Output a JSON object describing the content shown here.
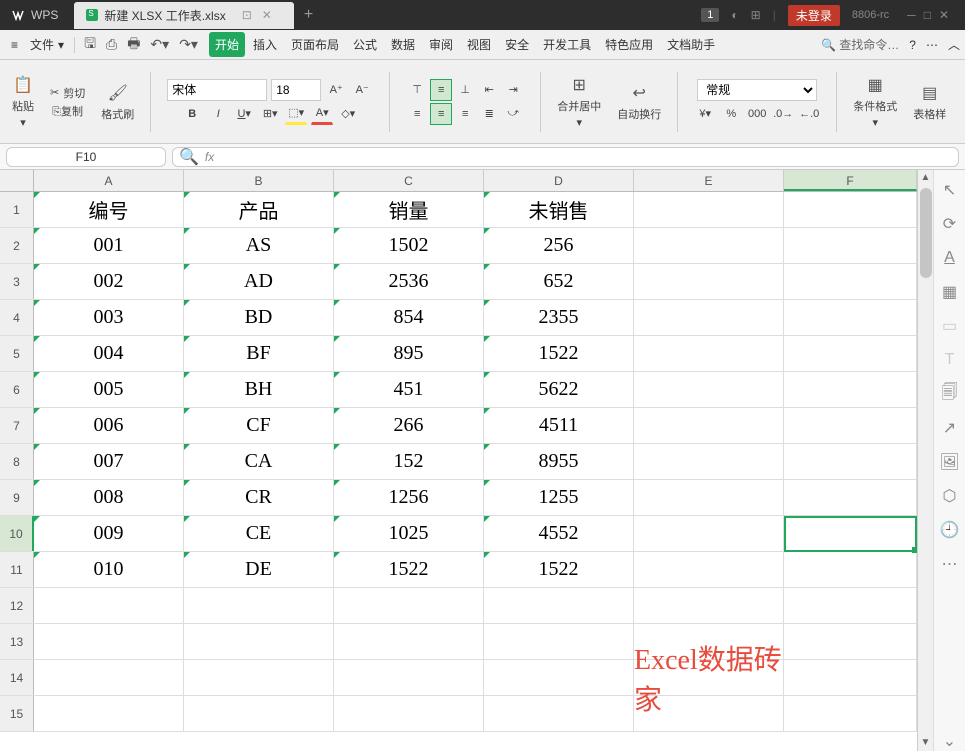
{
  "titlebar": {
    "app": "WPS",
    "tab_title": "新建 XLSX 工作表.xlsx",
    "badge": "1",
    "login": "未登录",
    "version": "8806-rc"
  },
  "menubar": {
    "file": "文件",
    "tabs": [
      "开始",
      "插入",
      "页面布局",
      "公式",
      "数据",
      "审阅",
      "视图",
      "安全",
      "开发工具",
      "特色应用",
      "文档助手"
    ],
    "search_placeholder": "查找命令…"
  },
  "ribbon": {
    "paste": "粘贴",
    "cut": "剪切",
    "copy": "复制",
    "format_painter": "格式刷",
    "font_name": "宋体",
    "font_size": "18",
    "merge": "合并居中",
    "wrap": "自动换行",
    "num_format": "常规",
    "cond_fmt": "条件格式",
    "cell_style": "表格样"
  },
  "namebox": {
    "ref": "F10"
  },
  "columns": [
    "A",
    "B",
    "C",
    "D",
    "E",
    "F"
  ],
  "col_widths": [
    "150",
    "150",
    "150",
    "150",
    "150",
    "133"
  ],
  "headers": [
    "编号",
    "产品",
    "销量",
    "未销售"
  ],
  "rows": [
    {
      "a": "001",
      "b": "AS",
      "c": "1502",
      "d": "256"
    },
    {
      "a": "002",
      "b": "AD",
      "c": "2536",
      "d": "652"
    },
    {
      "a": "003",
      "b": "BD",
      "c": "854",
      "d": "2355"
    },
    {
      "a": "004",
      "b": "BF",
      "c": "895",
      "d": "1522"
    },
    {
      "a": "005",
      "b": "BH",
      "c": "451",
      "d": "5622"
    },
    {
      "a": "006",
      "b": "CF",
      "c": "266",
      "d": "4511"
    },
    {
      "a": "007",
      "b": "CA",
      "c": "152",
      "d": "8955"
    },
    {
      "a": "008",
      "b": "CR",
      "c": "1256",
      "d": "1255"
    },
    {
      "a": "009",
      "b": "CE",
      "c": "1025",
      "d": "4552"
    },
    {
      "a": "010",
      "b": "DE",
      "c": "1522",
      "d": "1522"
    }
  ],
  "watermark": "Excel数据砖家",
  "selected_cell": "F10"
}
